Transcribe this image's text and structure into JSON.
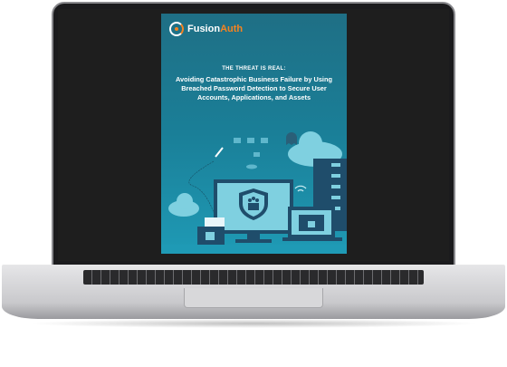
{
  "cover": {
    "brand_prefix": "Fusion",
    "brand_suffix": "Auth",
    "kicker": "THE THREAT IS REAL:",
    "title": "Avoiding Catastrophic Business Failure by Using Breached Password Detection to Secure User Accounts, Applications, and Assets"
  },
  "colors": {
    "brand_orange": "#f58320",
    "cover_teal": "#1a7f98"
  },
  "icons": [
    "shield-people-icon",
    "lock-icon",
    "cloud-icon",
    "server-rack-icon",
    "wifi-icon",
    "rocket-icon",
    "ghost-icon",
    "space-invader-icon"
  ]
}
